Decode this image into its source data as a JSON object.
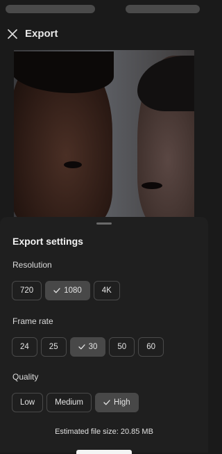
{
  "header": {
    "title": "Export",
    "close_icon": "close-icon"
  },
  "settings": {
    "title": "Export settings",
    "resolution": {
      "label": "Resolution",
      "options": [
        "720",
        "1080",
        "4K"
      ],
      "selected": "1080"
    },
    "frame_rate": {
      "label": "Frame rate",
      "options": [
        "24",
        "25",
        "30",
        "50",
        "60"
      ],
      "selected": "30"
    },
    "quality": {
      "label": "Quality",
      "options": [
        "Low",
        "Medium",
        "High"
      ],
      "selected": "High"
    },
    "estimated_size": "Estimated file size: 20.85 MB"
  },
  "colors": {
    "background": "#1a1a1a",
    "sheet": "#1f1f1f",
    "chip_selected": "#484848",
    "chip_border": "#4a4a4a"
  }
}
